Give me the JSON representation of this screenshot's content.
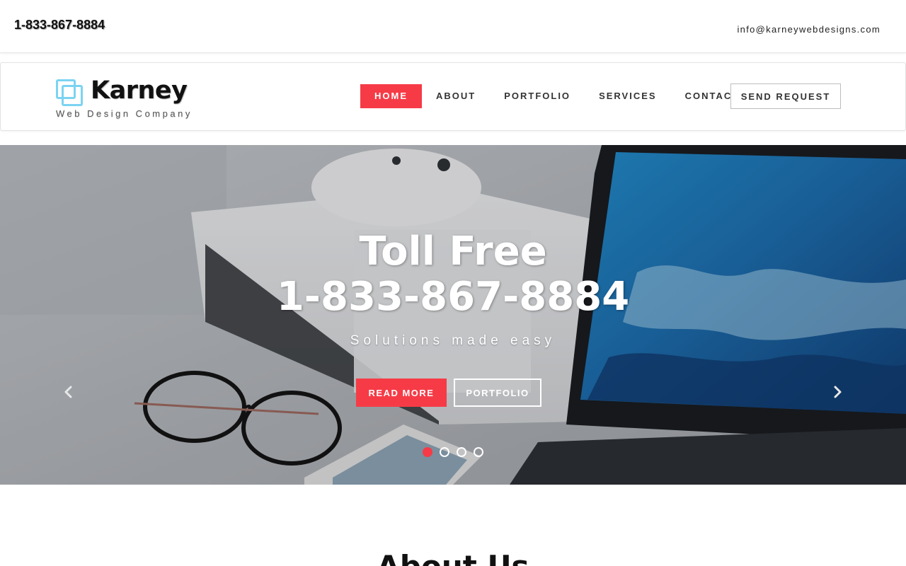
{
  "topbar": {
    "phone": "1-833-867-8884",
    "email": "info@karneywebdesigns.com"
  },
  "logo": {
    "name": "Karney",
    "tagline": "Web Design Company",
    "accent_color": "#7cd3f2"
  },
  "nav": {
    "items": [
      {
        "label": "HOME",
        "active": true
      },
      {
        "label": "ABOUT",
        "active": false
      },
      {
        "label": "PORTFOLIO",
        "active": false
      },
      {
        "label": "SERVICES",
        "active": false
      },
      {
        "label": "CONTACT",
        "active": false
      }
    ],
    "send_request": "SEND REQUEST"
  },
  "hero": {
    "title": "Toll Free",
    "phone": "1-833-867-8884",
    "subtitle": "Solutions made easy",
    "read_more": "READ MORE",
    "portfolio": "PORTFOLIO",
    "prev_icon": "chevron-left-icon",
    "next_icon": "chevron-right-icon",
    "slides": 4,
    "active_slide": 1
  },
  "about": {
    "title": "About Us"
  },
  "colors": {
    "accent": "#f63b47",
    "text": "#222222"
  }
}
